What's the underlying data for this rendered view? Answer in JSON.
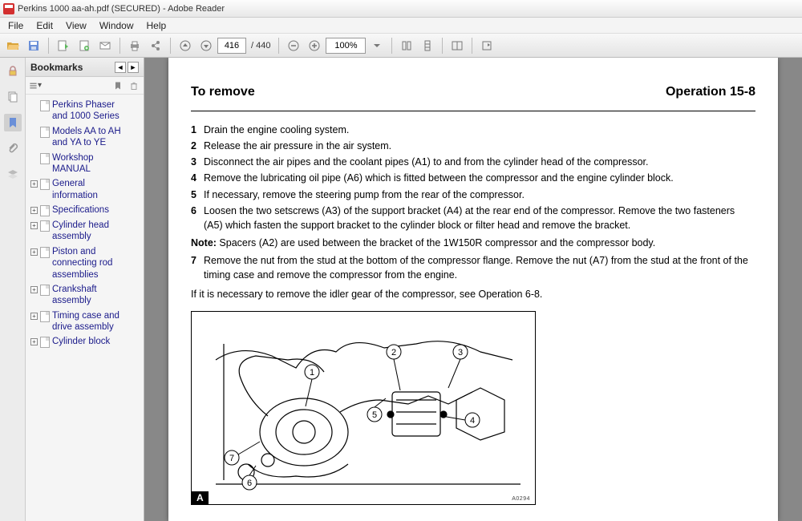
{
  "window": {
    "title": "Perkins 1000 aa-ah.pdf (SECURED) - Adobe Reader"
  },
  "menu": [
    "File",
    "Edit",
    "View",
    "Window",
    "Help"
  ],
  "toolbar": {
    "page_current": "416",
    "page_total": "/  440",
    "zoom": "100%"
  },
  "sidebar": {
    "title": "Bookmarks",
    "items": [
      {
        "label": "Perkins Phaser and 1000 Series",
        "expandable": false
      },
      {
        "label": "Models AA to AH and YA to YE",
        "expandable": false
      },
      {
        "label": "Workshop MANUAL",
        "expandable": false
      },
      {
        "label": "General information",
        "expandable": true
      },
      {
        "label": "Specifications",
        "expandable": true
      },
      {
        "label": "Cylinder head assembly",
        "expandable": true
      },
      {
        "label": "Piston and connecting rod assemblies",
        "expandable": true
      },
      {
        "label": "Crankshaft assembly",
        "expandable": true
      },
      {
        "label": "Timing case and drive assembly",
        "expandable": true
      },
      {
        "label": "Cylinder block",
        "expandable": true
      }
    ]
  },
  "doc": {
    "section_title": "To remove",
    "operation": "Operation 15-8",
    "steps": [
      {
        "n": "1",
        "t": "Drain the engine cooling system."
      },
      {
        "n": "2",
        "t": "Release the air pressure in the air system."
      },
      {
        "n": "3",
        "t": "Disconnect the air pipes and the coolant pipes (A1) to and from the cylinder head of the compressor."
      },
      {
        "n": "4",
        "t": "Remove the lubricating oil pipe (A6) which is fitted between the compressor and the engine cylinder block."
      },
      {
        "n": "5",
        "t": "If necessary, remove the steering pump from the rear of the compressor."
      },
      {
        "n": "6",
        "t": "Loosen the two setscrews (A3) of the support bracket (A4) at the rear end of the compressor. Remove the two fasteners (A5) which fasten the support bracket to the cylinder block or filter head and remove the bracket."
      }
    ],
    "note_label": "Note:",
    "note_text": "Spacers (A2) are used between the bracket of the 1W150R compressor and the compressor body.",
    "step7": {
      "n": "7",
      "t": "Remove the nut from the stud at the bottom of the compressor flange. Remove the nut (A7) from the stud at the front of the timing case and remove the compressor from the engine."
    },
    "tail": "If it is necessary to remove the idler gear of the compressor, see Operation 6-8.",
    "figure_label": "A",
    "figure_code": "A0294",
    "callouts": [
      "1",
      "2",
      "3",
      "4",
      "5",
      "6",
      "7"
    ]
  }
}
